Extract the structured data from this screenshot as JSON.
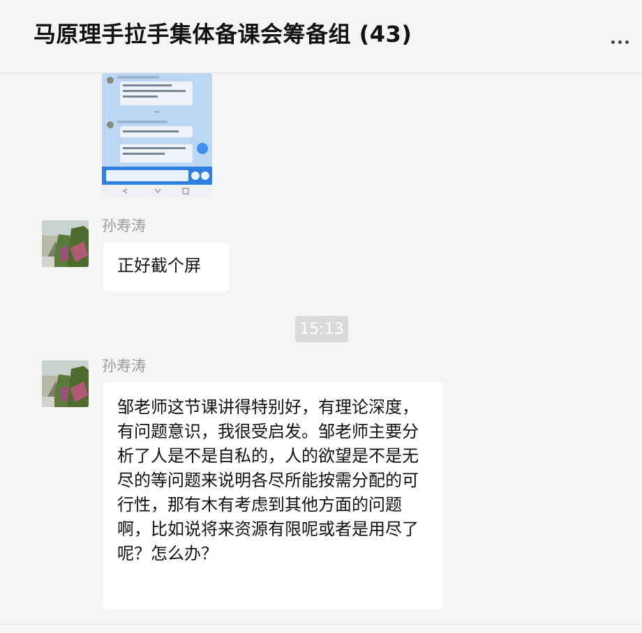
{
  "window": {
    "title": "马原理手拉手集体备课会筹备组 (43)",
    "controls": [
      "pin-icon",
      "minimize-icon",
      "maximize-icon",
      "close-icon"
    ]
  },
  "messages": [
    {
      "type": "image",
      "description_icon": "screenshot-thumbnail"
    },
    {
      "type": "text",
      "sender": "孙寿涛",
      "text": "正好截个屏"
    },
    {
      "type": "time",
      "text": "15:13"
    },
    {
      "type": "text",
      "sender": "孙寿涛",
      "text": "邹老师这节课讲得特别好，有理论深度，有问题意识，我很受启发。邹老师主要分析了人是不是自私的，人的欲望是不是无尽的等问题来说明各尽所能按需分配的可行性，那有木有考虑到其他方面的问题啊，比如说将来资源有限呢或者是用尽了呢？怎么办？"
    }
  ],
  "colors": {
    "background": "#f5f5f5",
    "bubble": "#ffffff",
    "time_pill": "#dadada",
    "sender": "#9a9a9a"
  }
}
